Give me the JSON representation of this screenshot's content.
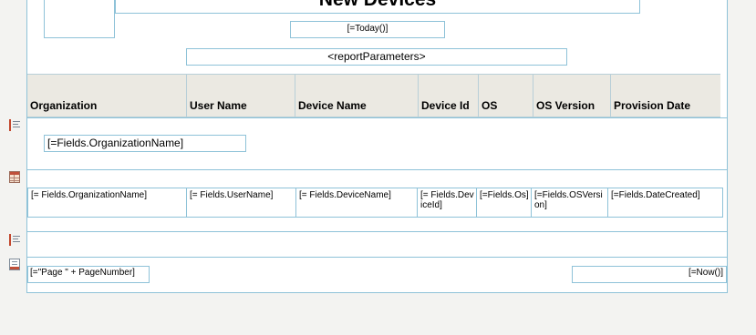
{
  "report": {
    "title": "New Devices",
    "today_expr": "[=Today()]",
    "params_expr": "<reportParameters>"
  },
  "table": {
    "headers": [
      "Organization",
      "User Name",
      "Device Name",
      "Device Id",
      "OS",
      "OS Version",
      "Provision Date"
    ],
    "group_expr": "[=Fields.OrganizationName]",
    "detail": [
      "[= Fields.OrganizationName]",
      "[= Fields.UserName]",
      "[= Fields.DeviceName]",
      "[= Fields.DeviceId]",
      "[=Fields.Os]",
      "[=Fields.OSVersion]",
      "[=Fields.DateCreated]"
    ]
  },
  "footer": {
    "page_expr": "[=\"Page \" + PageNumber]",
    "now_expr": "[=Now()]"
  },
  "icons": {
    "group_header": "group-header-icon",
    "detail_table": "table-detail-icon",
    "group_footer": "group-footer-icon",
    "page_footer": "page-footer-icon"
  }
}
